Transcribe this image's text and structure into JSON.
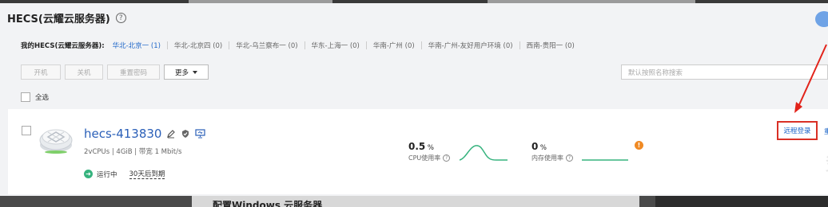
{
  "header": {
    "title": "HECS(云耀云服务器)",
    "help_icon": "?"
  },
  "filter": {
    "label": "我的HECS(云耀云服务器):",
    "regions": [
      {
        "label": "华北-北京一 (1)",
        "active": true
      },
      {
        "label": "华北-北京四 (0)",
        "active": false
      },
      {
        "label": "华北-乌兰察布一 (0)",
        "active": false
      },
      {
        "label": "华东-上海一 (0)",
        "active": false
      },
      {
        "label": "华南-广州 (0)",
        "active": false
      },
      {
        "label": "华南-广州-友好用户环境 (0)",
        "active": false
      },
      {
        "label": "西南-贵阳一 (0)",
        "active": false
      }
    ]
  },
  "toolbar": {
    "power_on": "开机",
    "power_off": "关机",
    "reset_password": "重置密码",
    "more": "更多"
  },
  "search": {
    "placeholder": "默认按照名称搜索"
  },
  "select_all": "全选",
  "server": {
    "name": "hecs-413830",
    "spec": "2vCPUs | 4GiB | 带宽 1 Mbit/s",
    "status": "运行中",
    "expire": "30天后到期",
    "cpu": {
      "value": "0.5",
      "unit": "%",
      "label": "CPU使用率"
    },
    "memory": {
      "value": "0",
      "unit": "%",
      "label": "内存使用率"
    },
    "warning": "!",
    "remote_login": "远程登录",
    "more_action": "重"
  },
  "background_text": "配置Windows 云服务器",
  "colors": {
    "link": "#1f67c9",
    "running": "#36b37e",
    "warning": "#f08a24",
    "highlight": "#d93025"
  }
}
